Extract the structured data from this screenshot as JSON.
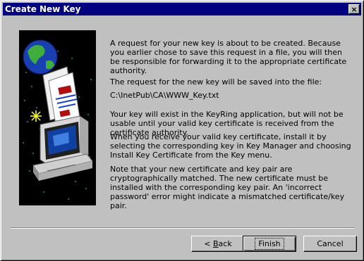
{
  "window": {
    "title": "Create New Key",
    "close_glyph": "×"
  },
  "content": {
    "paragraph1": "A request for your new key is about to be created. Because you earlier chose to save this request in a file, you will then be responsible for forwarding it to the appropriate certificate authority.",
    "paragraph2": "The request for the new key will be saved into the file:",
    "file_path": "C:\\InetPub\\CA\\WWW_Key.txt",
    "paragraph3": "Your key will exist in the KeyRing application, but will not be usable until your valid key certificate is received from the certificate authority.",
    "paragraph4": "When you receive your valid key certificate, install it by selecting the corresponding key in Key Manager and choosing Install Key Certificate from the Key menu.",
    "paragraph5": "Note that your new certificate and key pair are cryptographically matched. The new certificate must be installed with the corresponding key pair. An 'incorrect password' error might indicate a mismatched certificate/key pair."
  },
  "buttons": {
    "back_prefix": "< ",
    "back_mnemonic": "B",
    "back_rest": "ack",
    "finish": "Finish",
    "cancel": "Cancel"
  },
  "icons": {
    "wizard_illustration": "globe-documents-computer-illustration",
    "close": "close-icon"
  },
  "colors": {
    "titlebar": "#000080",
    "face": "#c0c0c0"
  }
}
